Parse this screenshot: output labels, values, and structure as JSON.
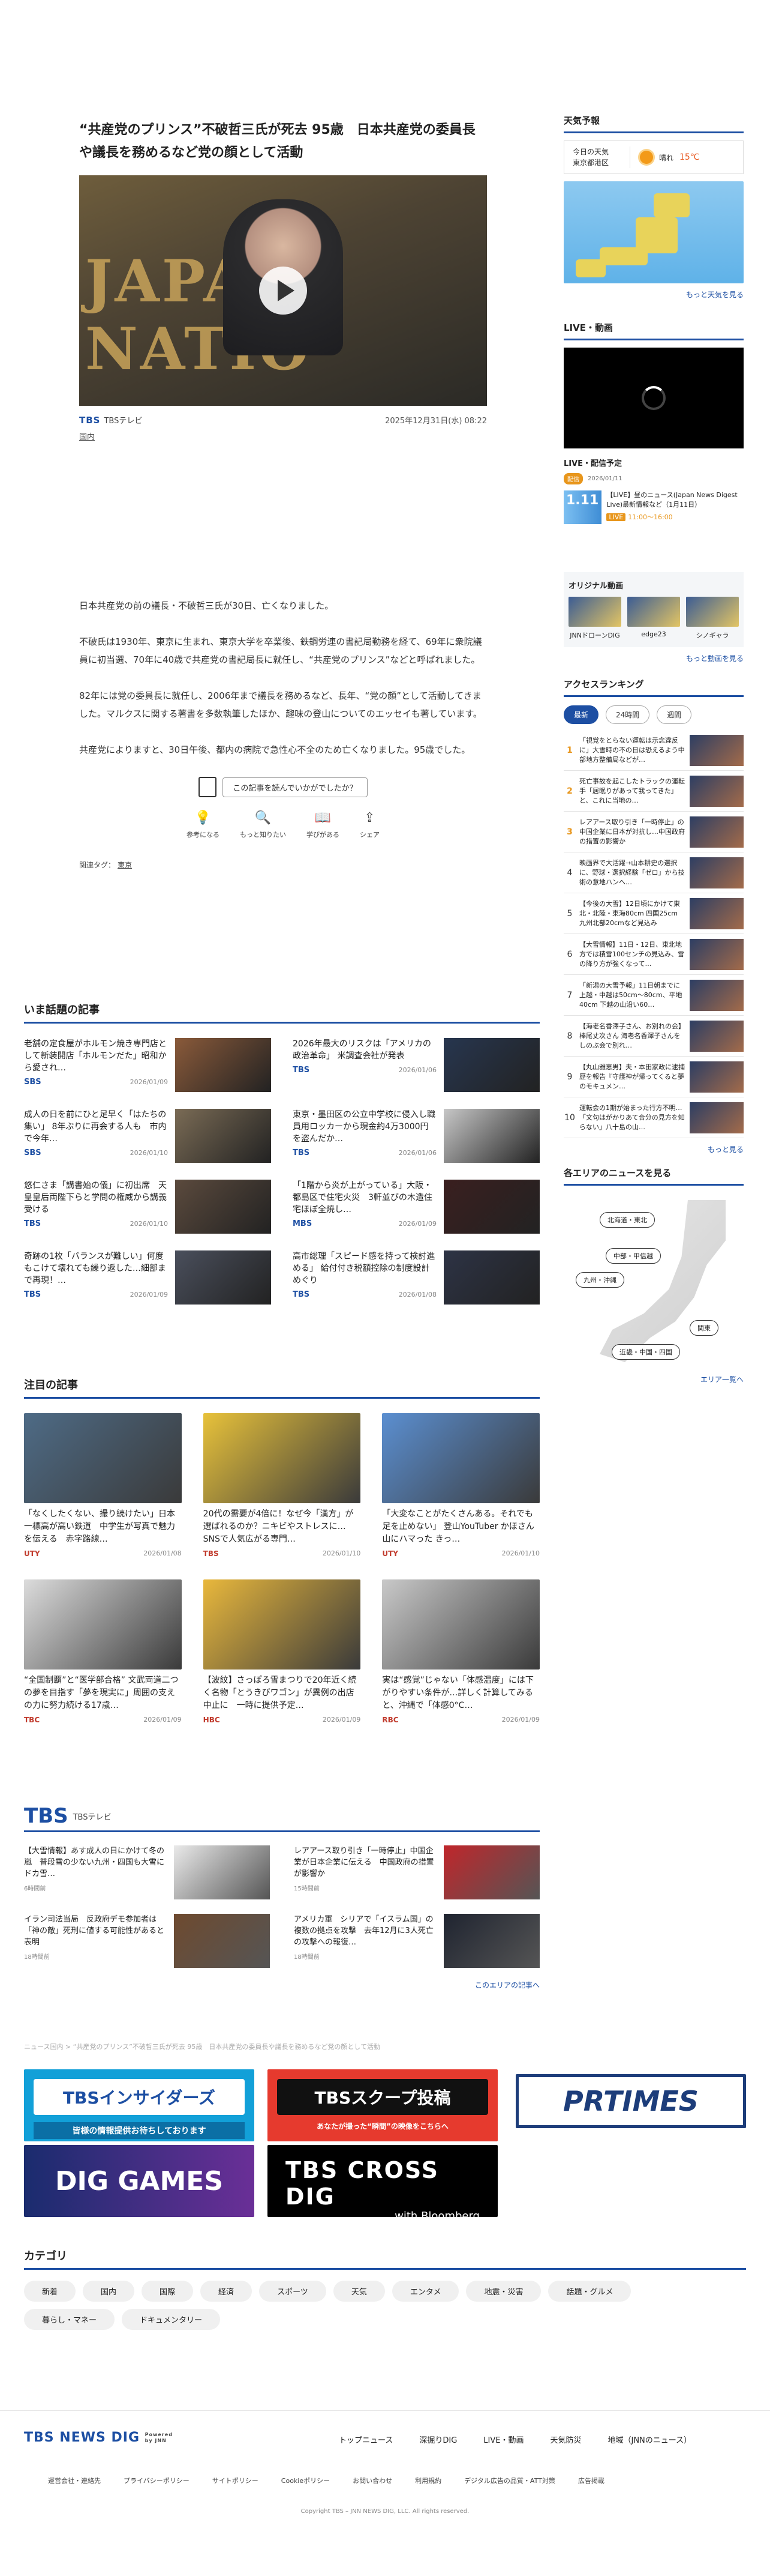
{
  "article": {
    "title": "“共産党のプリンス”不破哲三氏が死去 95歳　日本共産党の委員長や議長を務めるなど党の顔として活動",
    "source": "TBSテレビ",
    "date": "2025年12月31日(水) 08:22",
    "category": "国内",
    "paragraphs": [
      "日本共産党の前の議長・不破哲三氏が30日、亡くなりました。",
      "不破氏は1930年、東京に生まれ、東京大学を卒業後、鉄鋼労連の書記局勤務を経て、69年に衆院議員に初当選、70年に40歳で共産党の書記局長に就任し、“共産党のプリンス”などと呼ばれました。",
      "82年には党の委員長に就任し、2006年まで議長を務めるなど、長年、“党の顔”として活動してきました。マルクスに関する著書を多数執筆したほか、趣味の登山についてのエッセイも著しています。",
      "共産党によりますと、30日午後、都内の病院で急性心不全のため亡くなりました。95歳でした。"
    ],
    "feedback_question": "この記事を読んでいかがでしたか？",
    "reactions": [
      "参考になる",
      "もっと知りたい",
      "学びがある",
      "シェア"
    ],
    "tag_label": "関連タグ：",
    "tag": "東京"
  },
  "sidebar": {
    "weather_heading": "天気予報",
    "weather_place": [
      "今日の天気",
      "東京都港区"
    ],
    "weather_condition": "晴れ",
    "weather_temp": "15℃",
    "weather_more": "もっと天気を見る",
    "live_heading": "LIVE・動画",
    "live_schedule_heading": "LIVE・配信予定",
    "live_badge": "配信",
    "live_badge_date": "2026/01/11",
    "live_thumb_text": "1.11",
    "live_item_text": "【LIVE】昼のニュース(Japan News Digest Live)最新情報など（1月11日）",
    "live_item_time_badge": "LIVE",
    "live_item_time": "11:00～16:00",
    "original_heading": "オリジナル動画",
    "original_items": [
      "JNNドローンDIG",
      "edge23",
      "シノギャラ"
    ],
    "original_more": "もっと動画を見る",
    "ranking_heading": "アクセスランキング",
    "ranking_tabs": [
      "最新",
      "24時間",
      "週間"
    ],
    "ranking": [
      "「視覚をとらない運転は示念違反に」大雪時の不の日は恐えるよう中部地方整備局などが…",
      "死亡事故を起こしたトラックの運転手「居眠りがあって我ってきた」と、これに当地の…",
      "レアアース取り引き「一時停止」の中国企業に日本が対抗し…中国政府の措置の影響か",
      "映画界で大活躍→山本耕史の選択に、野球・選択経験「ゼロ」から技術の意地ハンへ…",
      "【今後の大雪】12日頃にかけて東北・北陸・東海80cm 四国25cm 九州北部20cmなど見込み",
      "【大雪情報】11日・12日、東北地方では積雪100センチの見込み、雪の降り方が強くなって…",
      "「新潟の大雪予報」11日朝までに上越・中越は50cm〜80cm、平地40cm 下越の山沿い60…",
      "【海老名香澤子さん、お別れの会】棒尾丈次さん 海老名香澤子さんをしのぶ会で別れ…",
      "【丸山雅恵男】夫・本田家政に逮捕歴を報告『守護神が帰ってくると夢のモキュメン…",
      "運転会の1期が始まった行方不明…「文句はがかりあて合分の見方を知らない」八十島の山…"
    ],
    "ranking_more": "もっと見る",
    "area_heading": "各エリアのニュースを見る",
    "areas": [
      "北海道・東北",
      "中部・甲信越",
      "九州・沖縄",
      "関東",
      "近畿・中国・四国"
    ],
    "area_more": "エリア一覧へ"
  },
  "hot": {
    "heading": "いま話題の記事",
    "items": [
      {
        "title": "老舗の定食屋がホルモン焼き専門店として新装開店「ホルモンだた」昭和から愛され…",
        "src": "SBS",
        "date": "2026/01/09"
      },
      {
        "title": "2026年最大のリスクは「アメリカの政治革命」 米調査会社が発表",
        "src": "TBS",
        "date": "2026/01/06"
      },
      {
        "title": "成人の日を前にひと足早く「はたちの集い」 8年ぶりに再会する人も　市内で今年…",
        "src": "SBS",
        "date": "2026/01/10"
      },
      {
        "title": "東京・墨田区の公立中学校に侵入し職員用ロッカーから現金約4万3000円を盗んだか…",
        "src": "TBS",
        "date": "2026/01/06"
      },
      {
        "title": "悠仁さま「講書始の儀」に初出席　天皇皇后両陛下らと学問の権威から講義受ける",
        "src": "TBS",
        "date": "2026/01/10"
      },
      {
        "title": "「1階から炎が上がっている」大阪・都島区で住宅火災　3軒並びの木造住宅ほぼ全焼し…",
        "src": "MBS",
        "date": "2026/01/09"
      },
      {
        "title": "奇跡の1枚「バランスが難しい」何度もこけて壊れても繰り返した…細部まで再現！…",
        "src": "TBS",
        "date": "2026/01/09"
      },
      {
        "title": "高市総理「スピード感を持って検討進める」 給付付き税額控除の制度設計めぐり",
        "src": "TBS",
        "date": "2026/01/08"
      }
    ]
  },
  "featured": {
    "heading": "注目の記事",
    "items": [
      {
        "title": "「なくしたくない、撮り続けたい」日本一標高が高い鉄道　中学生が写真で魅力を伝える　赤字路線…",
        "src": "UTY",
        "date": "2026/01/08"
      },
      {
        "title": "20代の需要が4倍に！なぜ今「漢方」が選ばれるのか？ニキビやストレスに…SNSで人気広がる専門…",
        "src": "TBS",
        "date": "2026/01/10"
      },
      {
        "title": "「大変なことがたくさんある。それでも足を止めない」 登山YouTuber かほさん　山にハマった きっ…",
        "src": "UTY",
        "date": "2026/01/10"
      },
      {
        "title": "“全国制覇”と“医学部合格” 文武両道二つの夢を目指す「夢を現実に」周囲の支えの力に努力続ける17歳…",
        "src": "TBC",
        "date": "2026/01/09"
      },
      {
        "title": "【波紋】さっぽろ雪まつりで20年近く続く名物「とうきびワゴン」が異例の出店中止に　一時に提供予定…",
        "src": "HBC",
        "date": "2026/01/09"
      },
      {
        "title": "実は“感覚”じゃない「体感温度」には下がりやすい条件が…詳しく計算してみると、沖縄で「体感0°C…",
        "src": "RBC",
        "date": "2026/01/09"
      }
    ]
  },
  "tbs": {
    "logo": "TBS",
    "sublabel": "TBSテレビ",
    "items": [
      {
        "title": "【大雪情報】あす成人の日にかけて冬の嵐　普段雪の少ない九州・四国も大雪に　ドカ雪…",
        "date": "6時間前"
      },
      {
        "title": "レアアース取り引き「一時停止」中国企業が日本企業に伝える　中国政府の措置が影響か",
        "date": "15時間前"
      },
      {
        "title": "イラン司法当局　反政府デモ参加者は「神の敵」死刑に値する可能性があると表明",
        "date": "18時間前"
      },
      {
        "title": "アメリカ軍　シリアで「イスラム国」の複数の拠点を攻撃　去年12月に3人死亡の攻撃への報復…",
        "date": "18時間前"
      }
    ],
    "more": "このエリアの記事へ"
  },
  "breadcrumb": "ニュース国内 > “共産党のプリンス”不破哲三氏が死去 95歳　日本共産党の委員長や議長を務めるなど党の顔として活動",
  "banners": {
    "insider": "TBSインサイダーズ",
    "insider_sub": "皆様の情報提供お待ちしております",
    "scoop": "TBSスクープ投稿",
    "scoop_sub": "あなたが撮った“瞬間”の映像をこちらへ",
    "prtimes": "PRTIMES",
    "games": "DIG GAMES",
    "crossdig": "TBS CROSS DIG",
    "crossdig_sub": "with Bloomberg"
  },
  "categories": {
    "heading": "カテゴリ",
    "items": [
      "新着",
      "国内",
      "国際",
      "経済",
      "スポーツ",
      "天気",
      "エンタメ",
      "地震・災害",
      "話題・グルメ",
      "暮らし・マネー",
      "ドキュメンタリー"
    ]
  },
  "footer": {
    "logo": "TBS NEWS DIG",
    "logo_sub": "Powered by JNN",
    "nav": [
      "トップニュース",
      "深掘りDIG",
      "LIVE・動画",
      "天気防災",
      "地域（JNNのニュース）"
    ],
    "links": [
      "運営会社・連絡先",
      "プライバシーポリシー",
      "サイトポリシー",
      "Cookieポリシー",
      "お問い合わせ",
      "利用規約",
      "デジタル広告の品質・ATT対策",
      "広告掲載"
    ],
    "copyright": "Copyright TBS – JNN NEWS DIG, LLC. All rights reserved."
  }
}
